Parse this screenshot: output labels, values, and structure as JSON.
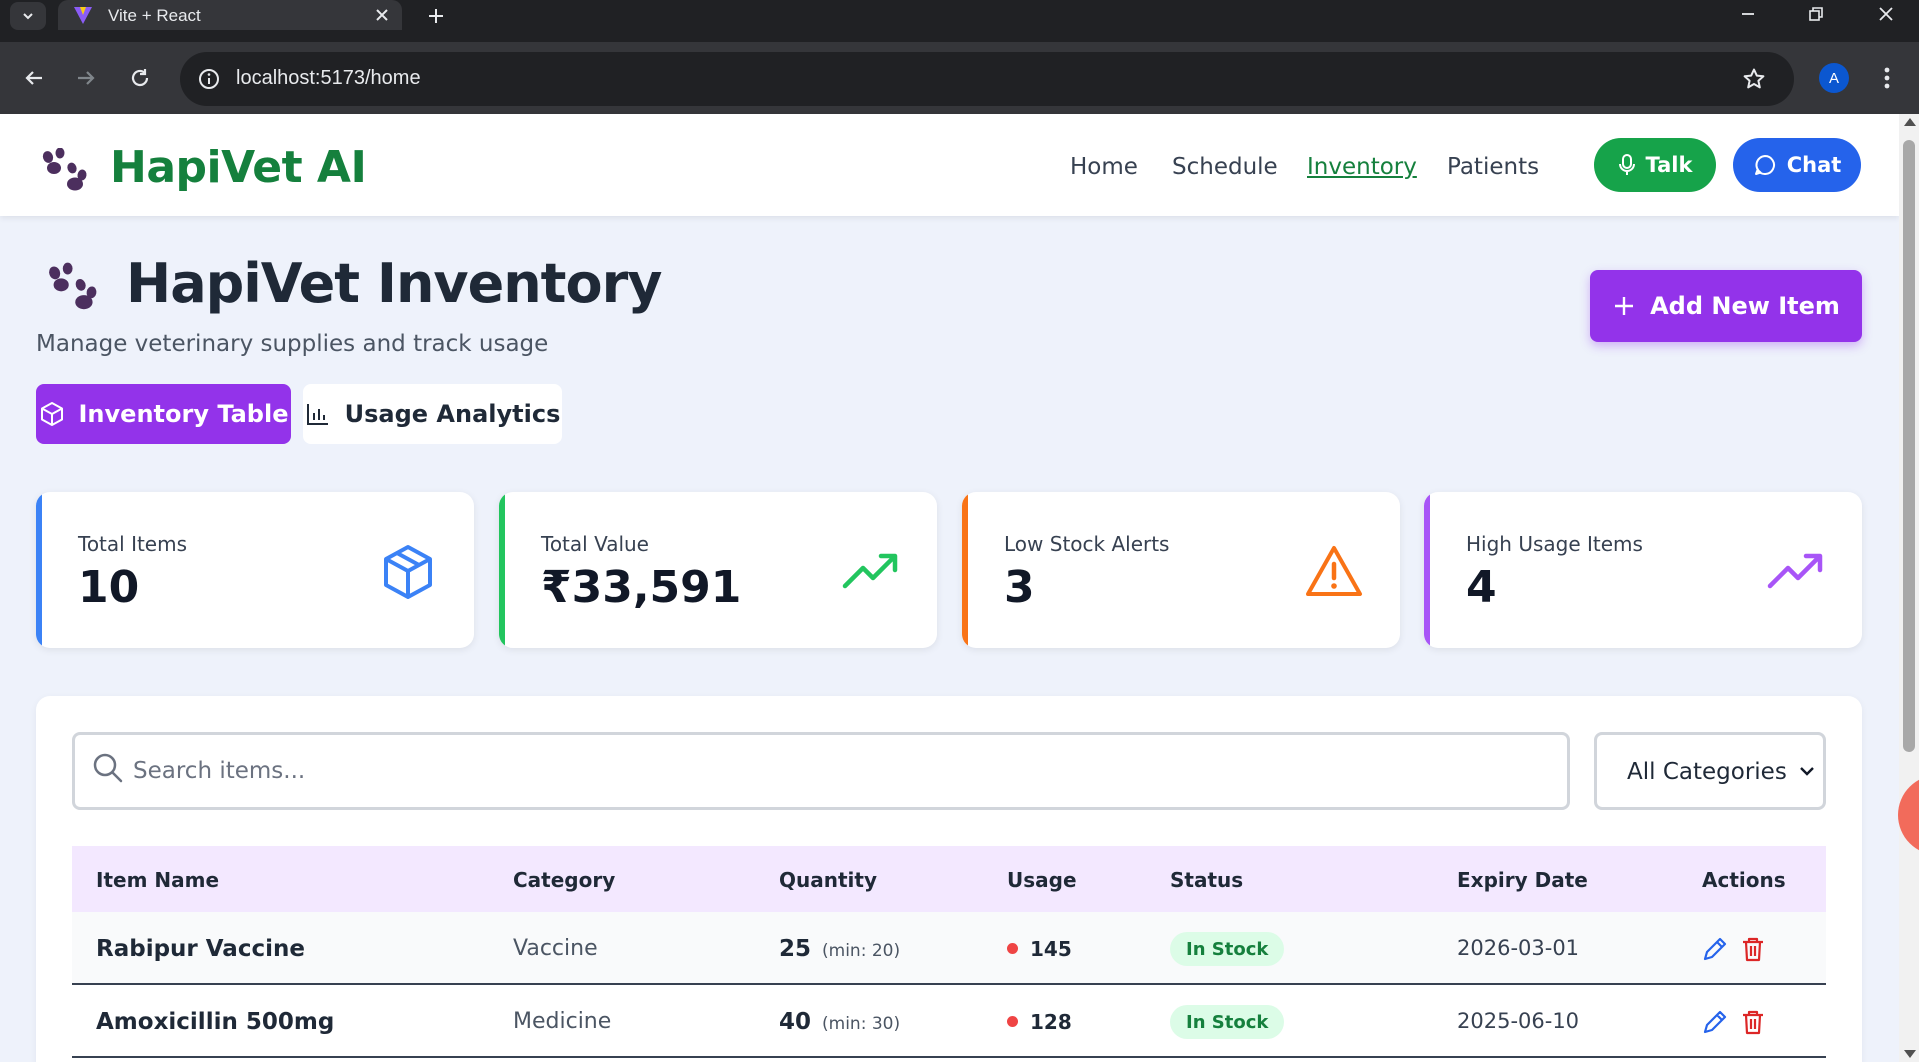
{
  "browser": {
    "tab_title": "Vite + React",
    "url": "localhost:5173/home",
    "profile_initial": "A"
  },
  "nav": {
    "brand": "HapiVet AI",
    "links": [
      "Home",
      "Schedule",
      "Inventory",
      "Patients"
    ],
    "active_link": "Inventory",
    "talk_label": "Talk",
    "chat_label": "Chat"
  },
  "header": {
    "title": "HapiVet Inventory",
    "subtitle": "Manage veterinary supplies and track usage",
    "add_button": "Add New Item"
  },
  "tabs": {
    "inventory_table": "Inventory Table",
    "usage_analytics": "Usage Analytics",
    "active": "Inventory Table"
  },
  "stats": [
    {
      "label": "Total Items",
      "value": "10",
      "icon": "box-icon",
      "color": "#3b82f6"
    },
    {
      "label": "Total Value",
      "value": "₹33,591",
      "icon": "trending-up-icon",
      "color": "#22c55e"
    },
    {
      "label": "Low Stock Alerts",
      "value": "3",
      "icon": "warning-icon",
      "color": "#f97316"
    },
    {
      "label": "High Usage Items",
      "value": "4",
      "icon": "trending-up-icon",
      "color": "#a855f7"
    }
  ],
  "filters": {
    "search_placeholder": "Search items...",
    "category_selected": "All Categories"
  },
  "table": {
    "columns": [
      "Item Name",
      "Category",
      "Quantity",
      "Usage",
      "Status",
      "Expiry Date",
      "Actions"
    ],
    "rows": [
      {
        "name": "Rabipur Vaccine",
        "category": "Vaccine",
        "quantity": "25",
        "min": "(min: 20)",
        "usage": "145",
        "status": "In Stock",
        "expiry": "2026-03-01"
      },
      {
        "name": "Amoxicillin 500mg",
        "category": "Medicine",
        "quantity": "40",
        "min": "(min: 30)",
        "usage": "128",
        "status": "In Stock",
        "expiry": "2025-06-10"
      }
    ]
  },
  "colors": {
    "brand_green": "#15803d",
    "accent_purple": "#9333ea",
    "chat_blue": "#2563eb",
    "talk_green": "#16a34a"
  }
}
